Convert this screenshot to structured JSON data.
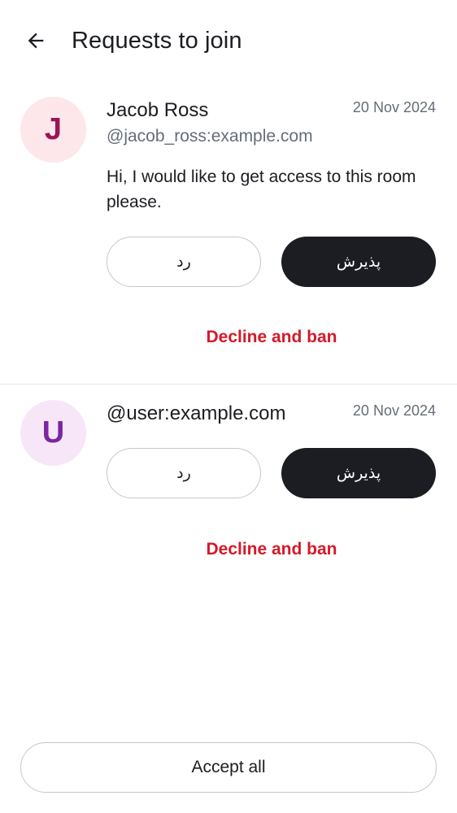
{
  "header": {
    "title": "Requests to join",
    "back_icon": "arrow-left-icon"
  },
  "requests": [
    {
      "avatar_letter": "J",
      "avatar_bg": "#fde7ea",
      "avatar_color": "#9b1556",
      "name": "Jacob Ross",
      "handle": "@jacob_ross:example.com",
      "date": "20 Nov 2024",
      "message": "Hi, I would like to get access to this room please.",
      "decline_label": "رد",
      "accept_label": "پذیرش",
      "ban_label": "Decline and ban"
    },
    {
      "avatar_letter": "U",
      "avatar_bg": "#f7e6f7",
      "avatar_color": "#7c25a0",
      "name": "@user:example.com",
      "date": "20 Nov 2024",
      "decline_label": "رد",
      "accept_label": "پذیرش",
      "ban_label": "Decline and ban"
    }
  ],
  "footer": {
    "accept_all_label": "Accept all"
  },
  "colors": {
    "accent_dark": "#1b1d22",
    "danger": "#d51928",
    "secondary_text": "#656d77"
  }
}
